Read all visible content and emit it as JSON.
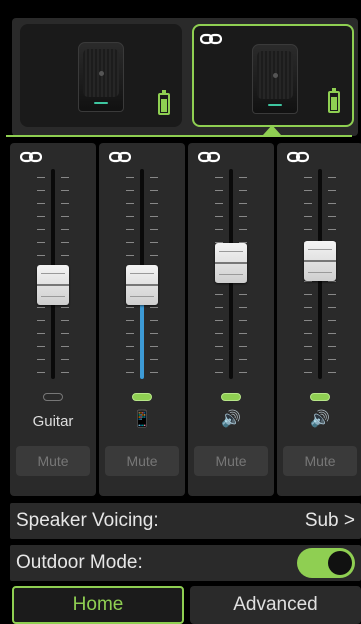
{
  "speakers": [
    {
      "name": "speaker-1",
      "selected": false,
      "battery": "battery-icon",
      "linked": false
    },
    {
      "name": "speaker-2",
      "selected": true,
      "battery": "battery-icon",
      "linked": true
    }
  ],
  "channels": [
    {
      "label": "Guitar",
      "icon": "",
      "fader_level": 0.45,
      "meter_level": 0,
      "indicator_on": false,
      "mute_label": "Mute"
    },
    {
      "label": "",
      "icon": "📱",
      "fader_level": 0.45,
      "meter_level": 0.43,
      "indicator_on": true,
      "mute_label": "Mute"
    },
    {
      "label": "",
      "icon": "🔊",
      "fader_level": 0.55,
      "meter_level": 0,
      "indicator_on": true,
      "mute_label": "Mute"
    },
    {
      "label": "",
      "icon": "🔊",
      "fader_level": 0.56,
      "meter_level": 0,
      "indicator_on": true,
      "mute_label": "Mute"
    }
  ],
  "speaker_voicing": {
    "label": "Speaker Voicing:",
    "value": "Sub >"
  },
  "outdoor_mode": {
    "label": "Outdoor Mode:",
    "on": true
  },
  "tabs": {
    "home": "Home",
    "advanced": "Advanced"
  },
  "colors": {
    "accent": "#8fcf52",
    "meter": "#3d9bd6"
  }
}
